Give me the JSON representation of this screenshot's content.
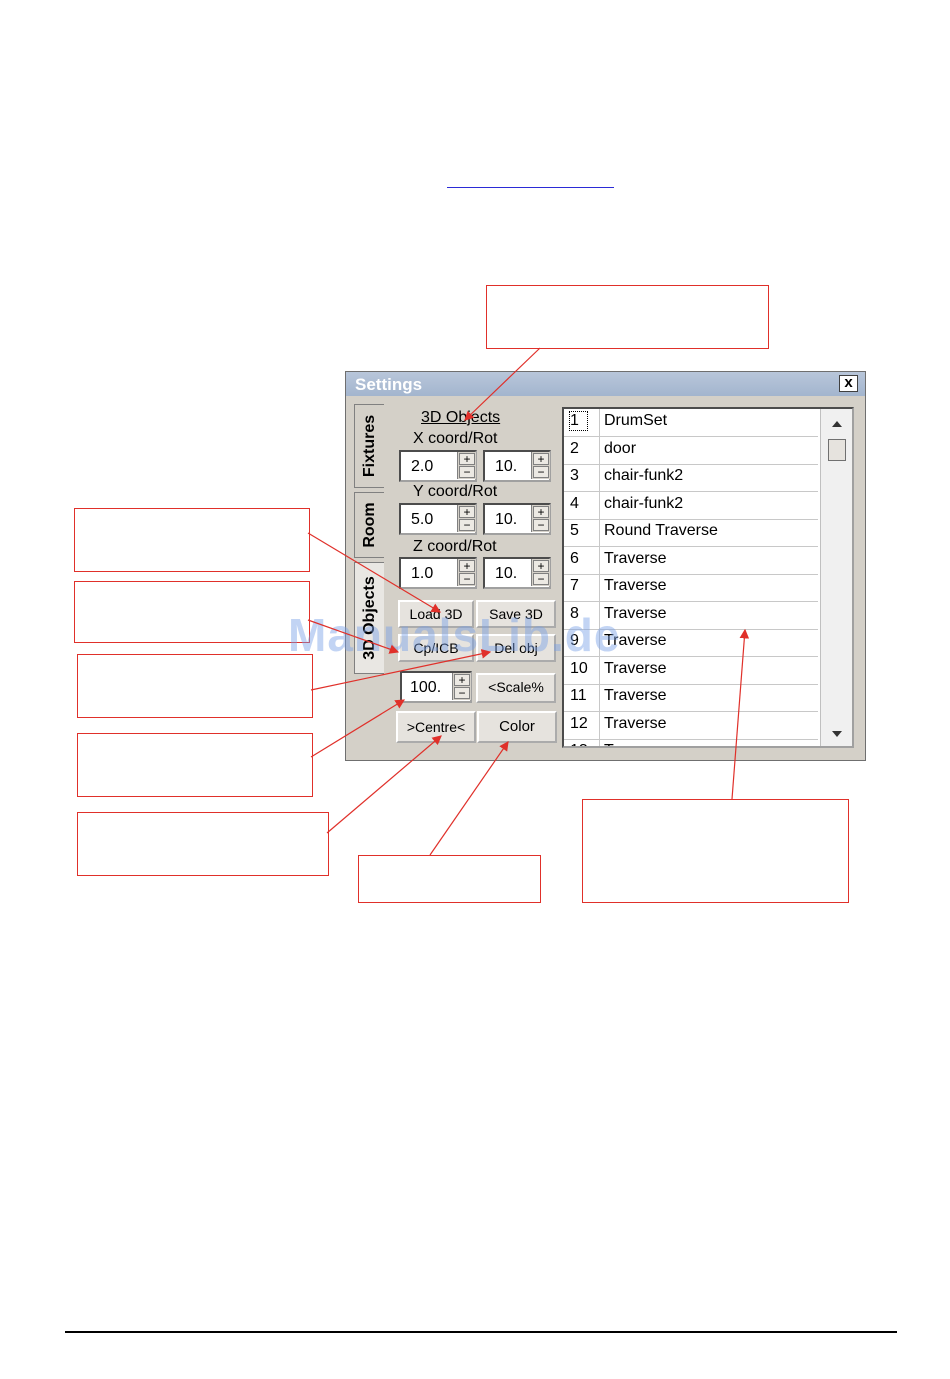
{
  "window": {
    "title": "Settings",
    "close_label": "x"
  },
  "tabs": [
    {
      "label": "Fixtures"
    },
    {
      "label": "Room"
    },
    {
      "label": "3D Objects"
    }
  ],
  "panel": {
    "title": "3D Objects",
    "x_label": "X coord/Rot",
    "x_value": "2.0",
    "x_rot": "10.",
    "y_label": "Y coord/Rot",
    "y_value": "5.0",
    "y_rot": "10.",
    "z_label": "Z coord/Rot",
    "z_value": "1.0",
    "z_rot": "10.",
    "load_label": "Load 3D",
    "save_label": "Save 3D",
    "copy_label": "Cp/ICB",
    "delete_label": "Del obj",
    "scale_value": "100.",
    "scale_label": "<Scale%",
    "centre_label": ">Centre<",
    "color_label": "Color",
    "spin_plus": "+",
    "spin_minus": "−"
  },
  "objects": [
    {
      "num": "1",
      "name": "DrumSet"
    },
    {
      "num": "2",
      "name": "door"
    },
    {
      "num": "3",
      "name": "chair-funk2"
    },
    {
      "num": "4",
      "name": "chair-funk2"
    },
    {
      "num": "5",
      "name": "Round Traverse"
    },
    {
      "num": "6",
      "name": "Traverse"
    },
    {
      "num": "7",
      "name": "Traverse"
    },
    {
      "num": "8",
      "name": "Traverse"
    },
    {
      "num": "9",
      "name": "Traverse"
    },
    {
      "num": "10",
      "name": "Traverse"
    },
    {
      "num": "11",
      "name": "Traverse"
    },
    {
      "num": "12",
      "name": "Traverse"
    },
    {
      "num": "13",
      "name": "Tr"
    }
  ],
  "scrollbar": {
    "up_icon": "up-arrow-icon",
    "down_icon": "down-arrow-icon"
  },
  "watermark": "ManualsLib.de",
  "colors": {
    "callout_border": "#e0302a",
    "arrow": "#e0302a",
    "titlebar": "#a3b5ce",
    "link": "#2b2bd6"
  }
}
